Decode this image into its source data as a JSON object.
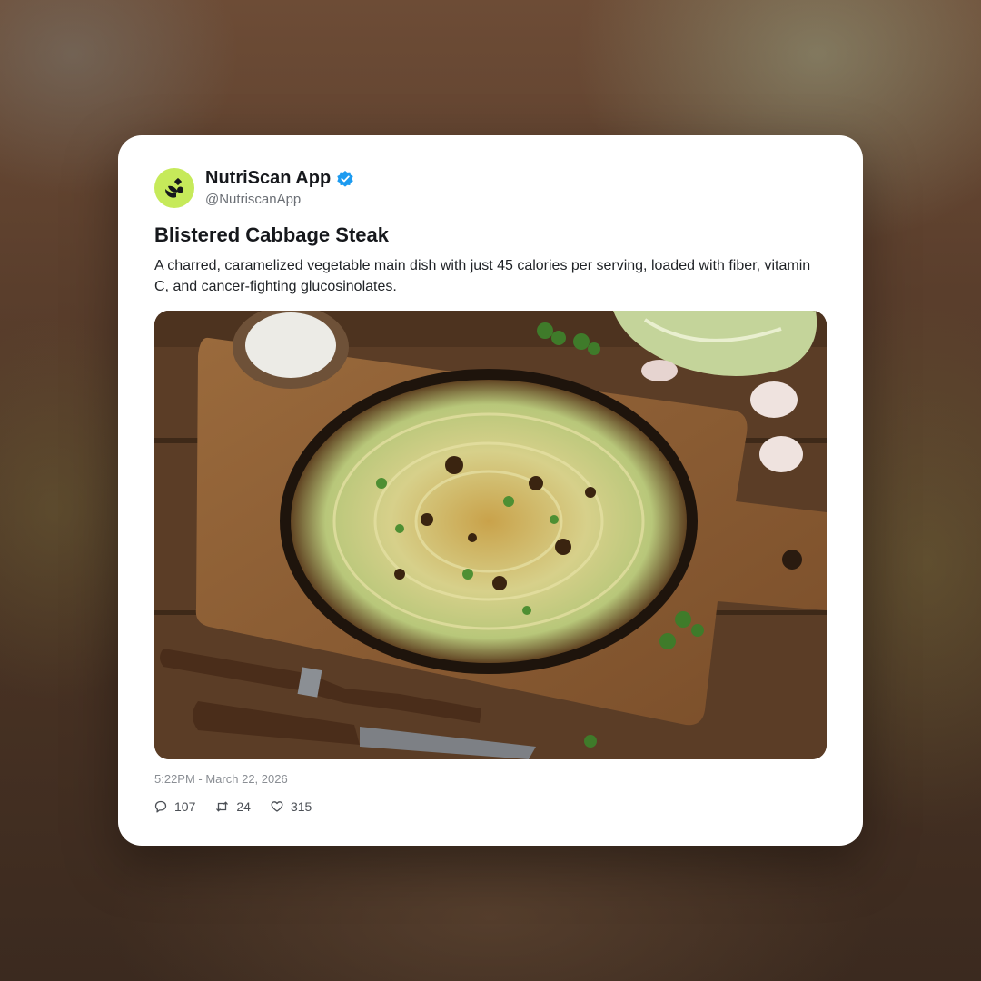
{
  "account": {
    "name": "NutriScan App",
    "handle": "@NutriscanApp",
    "verified": true
  },
  "post": {
    "title": "Blistered Cabbage Steak",
    "description": "A charred, caramelized vegetable main dish with just 45 calories per serving, loaded with fiber, vitamin C, and cancer-fighting glucosinolates.",
    "timestamp": "5:22PM - March 22, 2026"
  },
  "stats": {
    "replies": "107",
    "reposts": "24",
    "likes": "315"
  },
  "icons": {
    "avatar": "nutriscan-logo-icon",
    "verified": "verified-badge-icon",
    "replies": "comment-icon",
    "reposts": "repost-icon",
    "likes": "heart-icon"
  },
  "colors": {
    "avatar_bg": "#c6ea5a",
    "verified": "#1d9bf0",
    "card_bg": "#ffffff",
    "text_primary": "#16181c",
    "text_secondary": "#6b6f75"
  }
}
